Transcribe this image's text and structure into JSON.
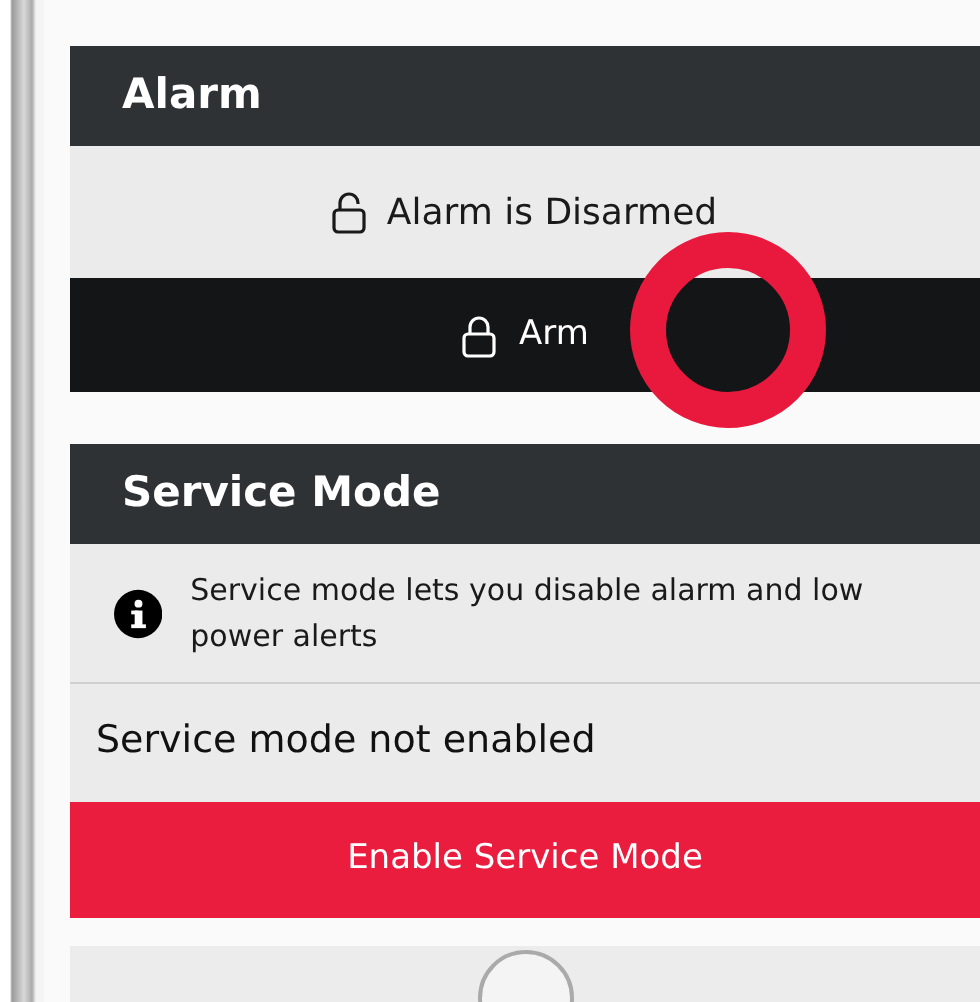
{
  "alarm": {
    "title": "Alarm",
    "status": {
      "text": "Alarm is Disarmed",
      "armed": false
    },
    "action": {
      "label": "Arm"
    }
  },
  "service_mode": {
    "title": "Service Mode",
    "info": "Service mode lets you disable alarm and low power alerts",
    "status": "Service mode not enabled",
    "action": {
      "label": "Enable Service Mode"
    }
  }
}
